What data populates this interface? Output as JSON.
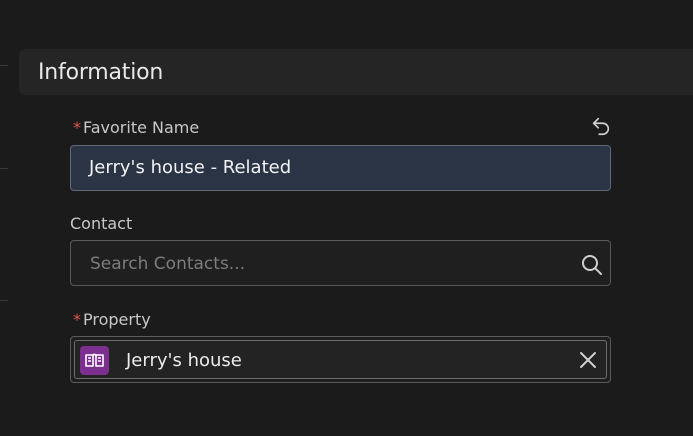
{
  "section": {
    "title": "Information"
  },
  "favorite_name": {
    "required_mark": "*",
    "label": "Favorite Name",
    "value": "Jerry's house - Related",
    "reset_icon": "undo-icon"
  },
  "contact": {
    "label": "Contact",
    "placeholder": "Search Contacts...",
    "search_icon": "search-icon"
  },
  "property": {
    "required_mark": "*",
    "label": "Property",
    "value": "Jerry's house",
    "entity_icon": "property-icon",
    "clear_icon": "close-icon"
  },
  "colors": {
    "background": "#1b1b1c",
    "section_header": "#252526",
    "required": "#e0534a",
    "name_field": "#2a3445",
    "entity_icon": "#7c2f8f"
  }
}
